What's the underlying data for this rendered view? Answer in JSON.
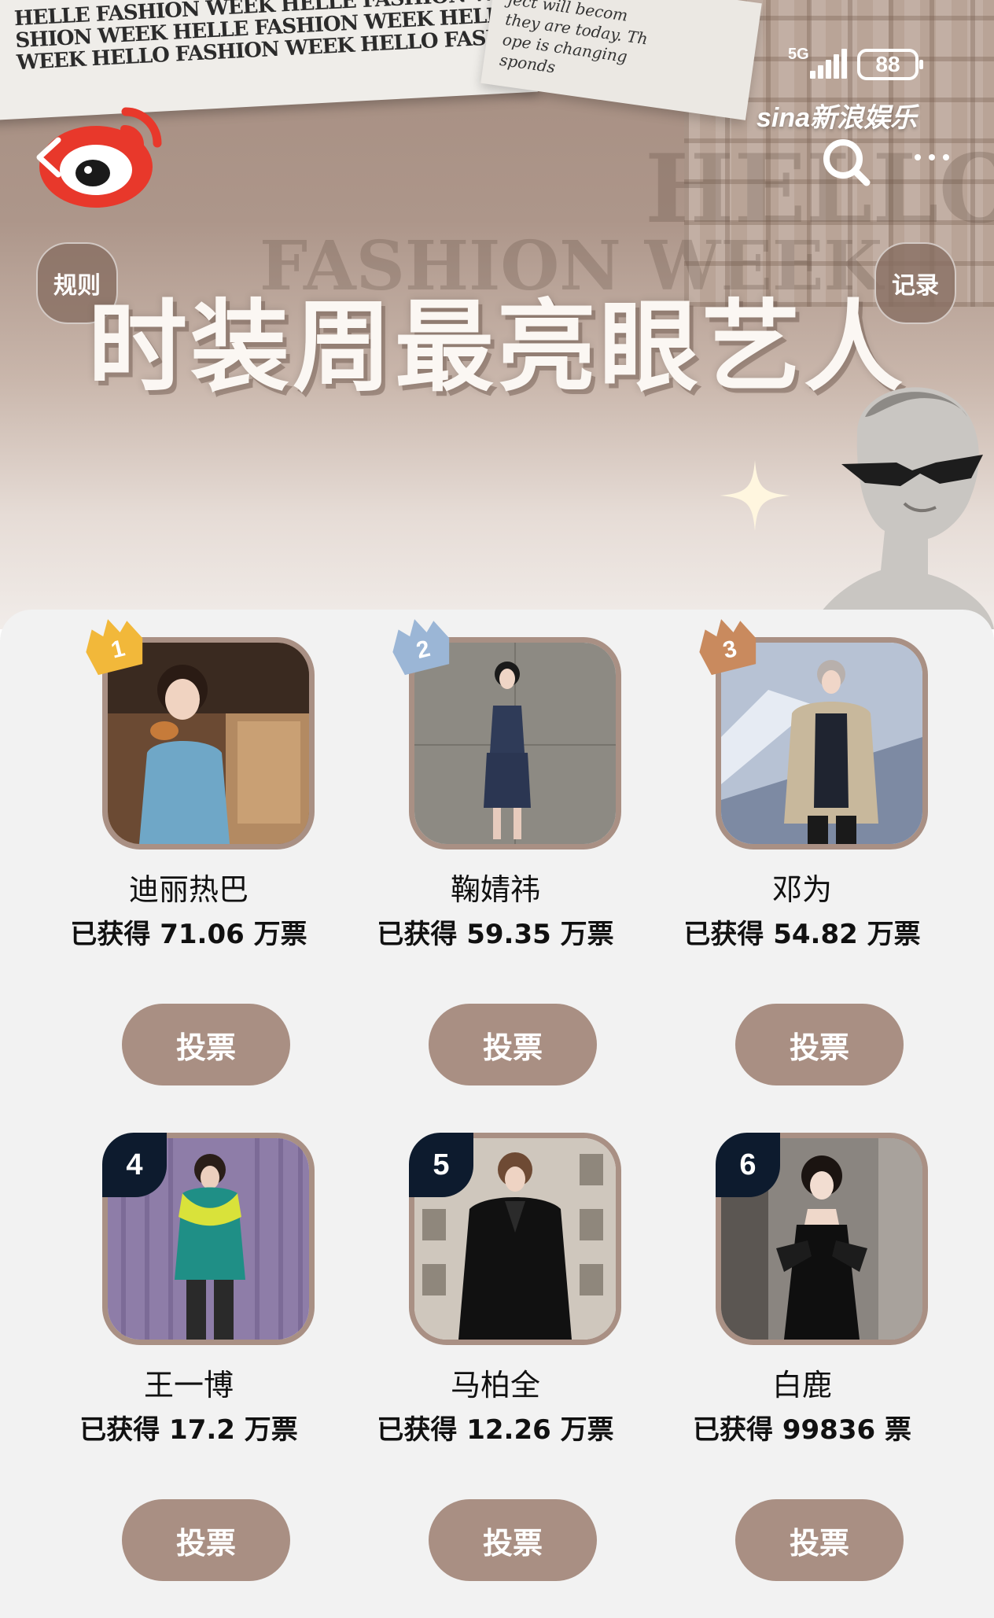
{
  "status_bar": {
    "network": "5G",
    "battery": "88"
  },
  "header": {
    "brand": "sina新浪娱乐",
    "title": "时装周最亮眼艺人",
    "rules_label": "规则",
    "records_label": "记录",
    "decor_text": {
      "newspaper_lines": [
        "HELLE FASHION WEEK   HELLE FASHION WEEK",
        "SHION WEEK   HELLE FASHION WEEK HELLE FASHION WEEK HELLE FASHION",
        "WEEK   HELLO FASHION WEEK HELLO FASHION WEEK"
      ],
      "clipping_lines": [
        "ject will becom",
        "they are today. Th",
        "ope is changing",
        "sponds"
      ],
      "ghost_1": "HELLO",
      "ghost_2": "FASHION WEEK"
    },
    "icons": [
      "back-icon",
      "weibo-logo-icon",
      "search-icon",
      "more-icon",
      "sparkle-icon",
      "statue-icon"
    ]
  },
  "colors": {
    "accent": "#a98f83",
    "panel_bg": "#f2f2f2",
    "rank_badge": "#0d1b2e",
    "medal_gold": "#f2b83a",
    "medal_silver": "#9bb6d6",
    "medal_bronze": "#c98a5e"
  },
  "artists": [
    {
      "rank": "1",
      "name": "迪丽热巴",
      "votes": "已获得 71.06 万票",
      "button": "投票",
      "badge": "gold-medal"
    },
    {
      "rank": "2",
      "name": "鞠婧祎",
      "votes": "已获得 59.35 万票",
      "button": "投票",
      "badge": "silver-medal"
    },
    {
      "rank": "3",
      "name": "邓为",
      "votes": "已获得 54.82 万票",
      "button": "投票",
      "badge": "bronze-medal"
    },
    {
      "rank": "4",
      "name": "王一博",
      "votes": "已获得 17.2 万票",
      "button": "投票",
      "badge": "number"
    },
    {
      "rank": "5",
      "name": "马柏全",
      "votes": "已获得 12.26 万票",
      "button": "投票",
      "badge": "number"
    },
    {
      "rank": "6",
      "name": "白鹿",
      "votes": "已获得 99836 票",
      "button": "投票",
      "badge": "number"
    }
  ]
}
